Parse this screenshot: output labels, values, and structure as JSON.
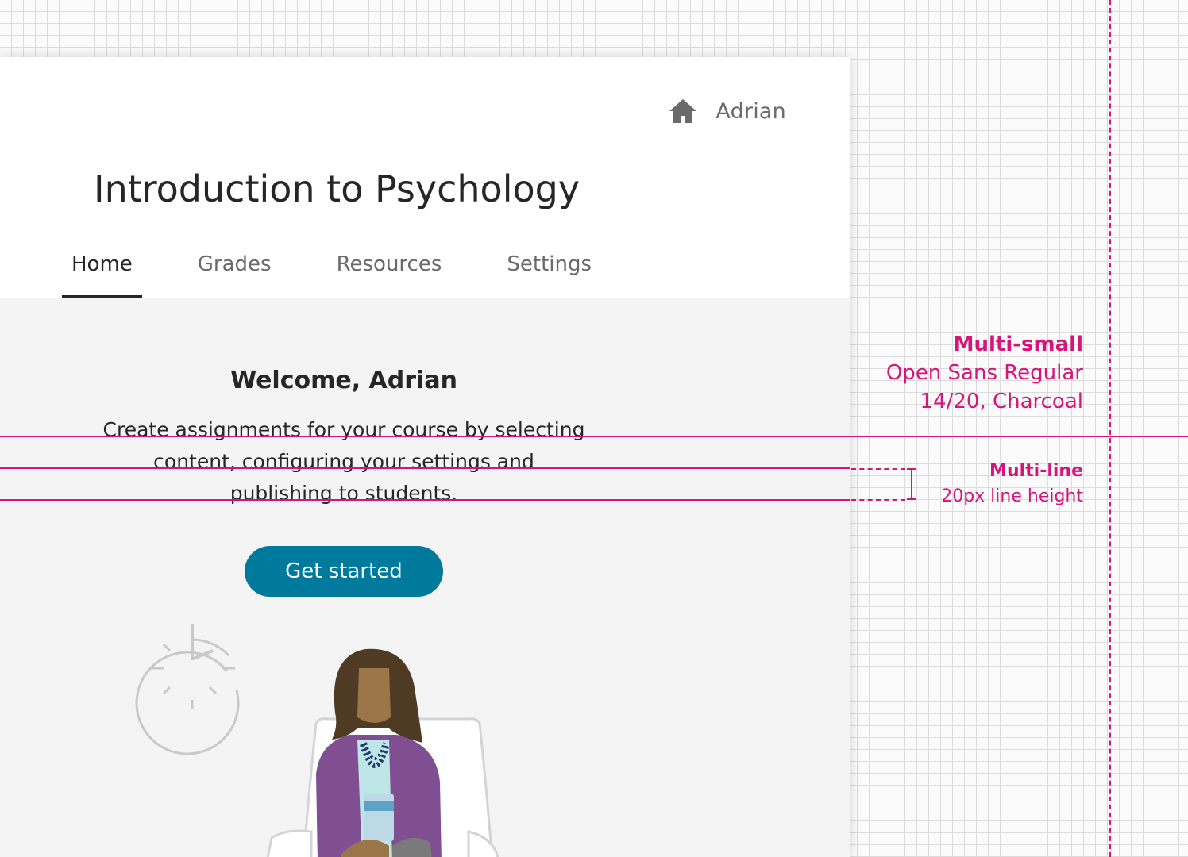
{
  "header": {
    "user_name": "Adrian",
    "icon": "home-icon"
  },
  "course": {
    "title": "Introduction to Psychology"
  },
  "tabs": [
    {
      "label": "Home",
      "active": true
    },
    {
      "label": "Grades",
      "active": false
    },
    {
      "label": "Resources",
      "active": false
    },
    {
      "label": "Settings",
      "active": false
    }
  ],
  "main": {
    "welcome": "Welcome, Adrian",
    "description_lines": [
      "Create assignments for your course by selecting",
      "content, configuring your settings and",
      "publishing to students."
    ],
    "cta_label": "Get started",
    "illustration": [
      "clock-icon",
      "woman-with-coffee"
    ]
  },
  "annotations": {
    "style_name": "Multi-small",
    "font_spec": "Open Sans Regular",
    "size_spec": "14/20, Charcoal",
    "multiline_title": "Multi-line",
    "multiline_note": "20px line height"
  },
  "colors": {
    "accent": "#007a9c",
    "guide": "#d6157a",
    "charcoal": "#262626",
    "muted": "#6a6a6a",
    "panel": "#f4f4f4"
  }
}
